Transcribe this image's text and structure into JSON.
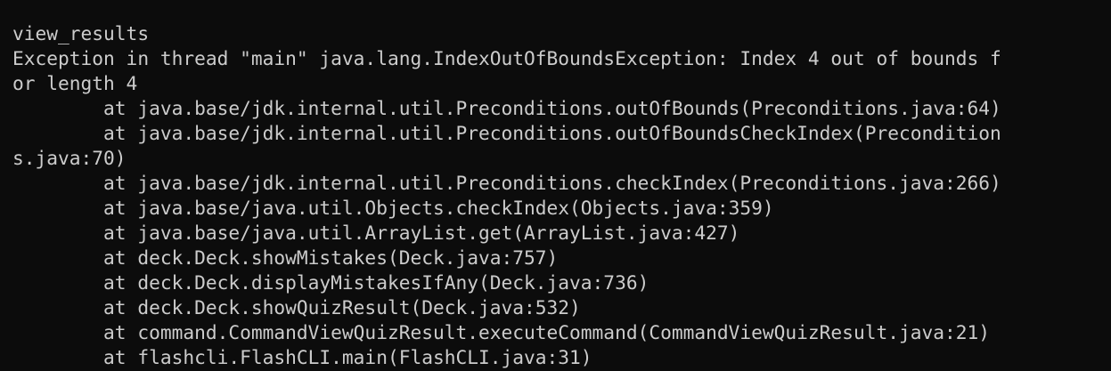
{
  "terminal": {
    "lines": [
      "view_results",
      "Exception in thread \"main\" java.lang.IndexOutOfBoundsException: Index 4 out of bounds f",
      "or length 4",
      "        at java.base/jdk.internal.util.Preconditions.outOfBounds(Preconditions.java:64)",
      "        at java.base/jdk.internal.util.Preconditions.outOfBoundsCheckIndex(Precondition",
      "s.java:70)",
      "        at java.base/jdk.internal.util.Preconditions.checkIndex(Preconditions.java:266)",
      "        at java.base/java.util.Objects.checkIndex(Objects.java:359)",
      "        at java.base/java.util.ArrayList.get(ArrayList.java:427)",
      "        at deck.Deck.showMistakes(Deck.java:757)",
      "        at deck.Deck.displayMistakesIfAny(Deck.java:736)",
      "        at deck.Deck.showQuizResult(Deck.java:532)",
      "        at command.CommandViewQuizResult.executeCommand(CommandViewQuizResult.java:21)",
      "        at flashcli.FlashCLI.main(FlashCLI.java:31)"
    ]
  }
}
